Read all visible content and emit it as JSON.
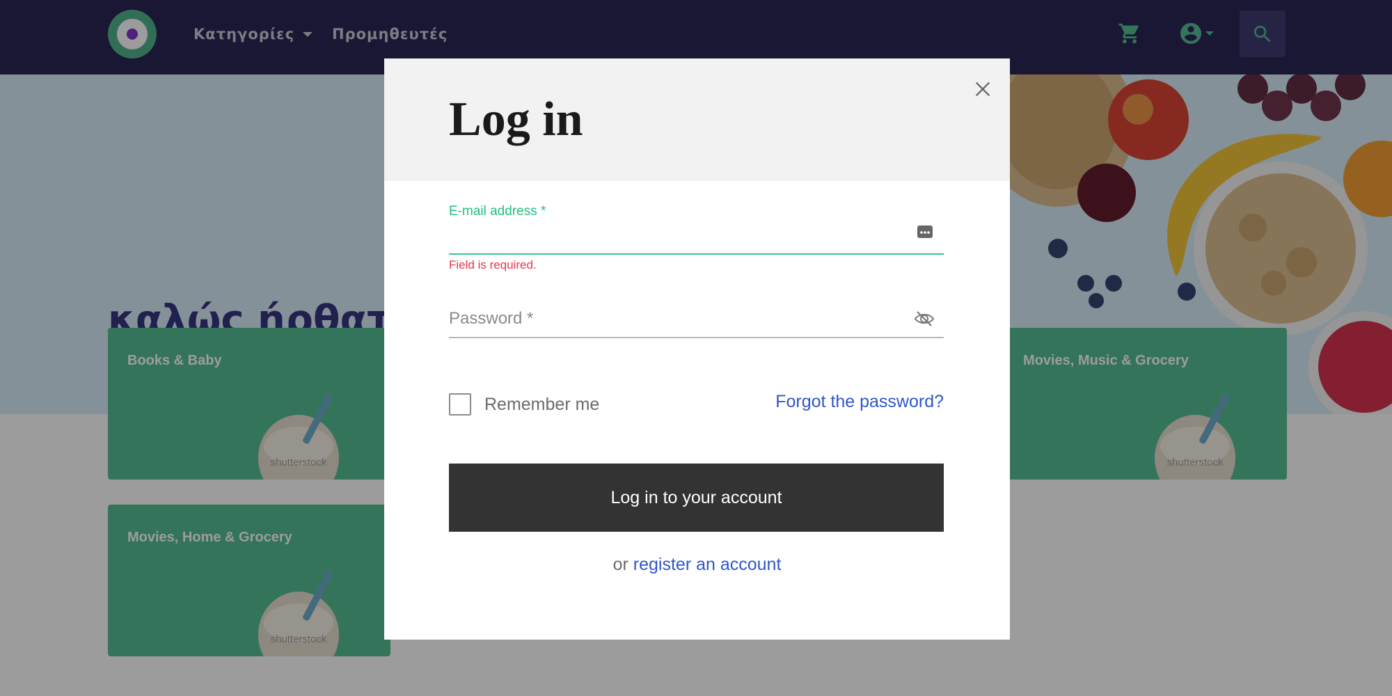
{
  "header": {
    "nav": {
      "categories_label": "Κατηγορίες",
      "suppliers_label": "Προμηθευτές"
    },
    "icons": [
      "logo",
      "cart-icon",
      "account-icon",
      "search-icon"
    ],
    "colors": {
      "background": "#1e1a4d",
      "accent": "#4dbb90"
    }
  },
  "hero": {
    "title": "καλώς ήρθατε!"
  },
  "categories": {
    "cards": [
      {
        "label": "Books & Baby",
        "image_watermark": "shutterstock"
      },
      {
        "label": "Movies, Music & Grocery",
        "image_watermark": "shutterstock"
      },
      {
        "label": "Movies, Home & Grocery",
        "image_watermark": "shutterstock"
      }
    ],
    "card_color": "#4dbb90"
  },
  "login_modal": {
    "title": "Log in",
    "email": {
      "label": "E-mail address *",
      "value": "",
      "error": "Field is required."
    },
    "password": {
      "placeholder": "Password *",
      "value": ""
    },
    "remember_me": {
      "label": "Remember me",
      "checked": false
    },
    "forgot_password_label": "Forgot the password?",
    "submit_label": "Log in to your account",
    "register": {
      "prefix": "or",
      "link_label": "register an account"
    },
    "colors": {
      "focus": "#1fbf7e",
      "error": "#e8334a",
      "link": "#2f57c8",
      "button": "#333333"
    }
  }
}
